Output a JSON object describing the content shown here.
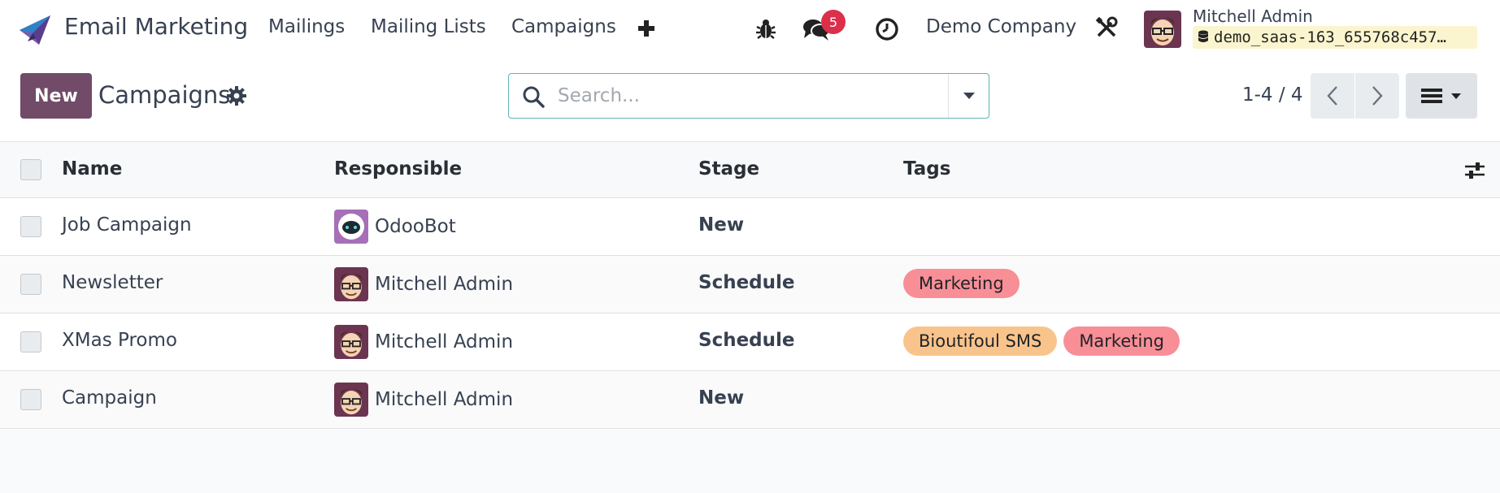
{
  "navbar": {
    "app_name": "Email Marketing",
    "menu": [
      "Mailings",
      "Mailing Lists",
      "Campaigns"
    ],
    "add_symbol": "+",
    "message_count": "5",
    "company": "Demo Company",
    "user_name": "Mitchell Admin",
    "database": "demo_saas-163_655768c457…",
    "icons": [
      "bug-icon",
      "chat-icon",
      "clock-icon",
      "tools-icon",
      "database-icon"
    ]
  },
  "control_panel": {
    "new_label": "New",
    "title": "Campaigns",
    "search_placeholder": "Search...",
    "pager": "1-4 / 4"
  },
  "list": {
    "columns": [
      "Name",
      "Responsible",
      "Stage",
      "Tags"
    ],
    "rows": [
      {
        "name": "Job Campaign",
        "responsible": "OdooBot",
        "stage": "New",
        "tags": []
      },
      {
        "name": "Newsletter",
        "responsible": "Mitchell Admin",
        "stage": "Schedule",
        "tags": [
          "Marketing"
        ]
      },
      {
        "name": "XMas Promo",
        "responsible": "Mitchell Admin",
        "stage": "Schedule",
        "tags": [
          "Bioutifoul SMS",
          "Marketing"
        ]
      },
      {
        "name": "Campaign",
        "responsible": "Mitchell Admin",
        "stage": "New",
        "tags": []
      }
    ]
  },
  "colors": {
    "primary": "#714b67",
    "badge": "#dc2f4a",
    "tag_marketing": "#f88e96",
    "tag_sms": "#f9c48b",
    "search_border": "#5cb3b5"
  }
}
